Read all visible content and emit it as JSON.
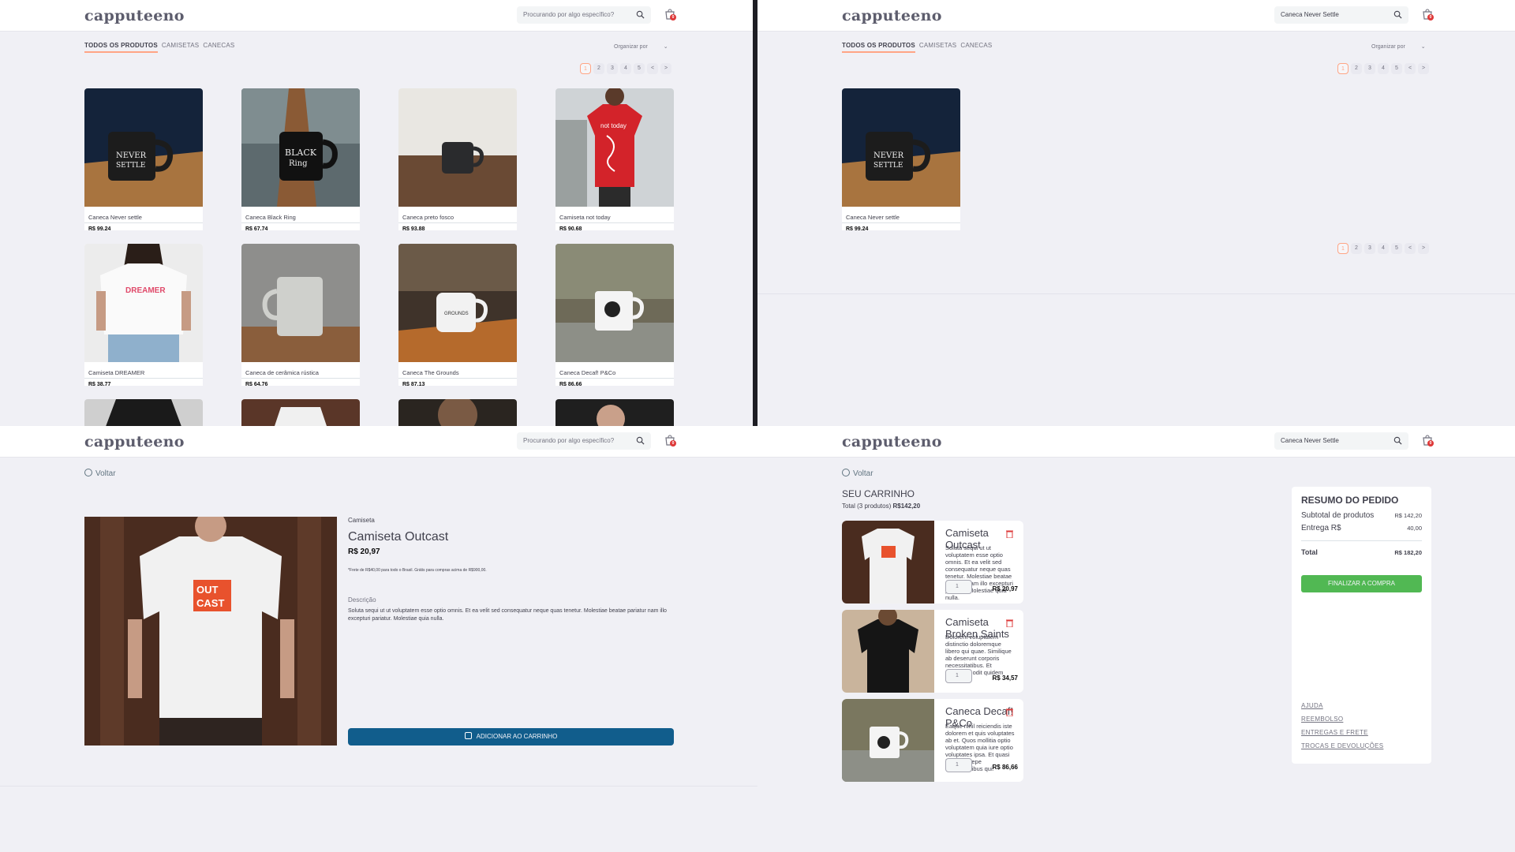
{
  "brand": "capputeeno",
  "search": {
    "placeholder": "Procurando por algo específico?",
    "query": "Caneca Never Settle"
  },
  "cart": {
    "count": "0",
    "icon": "shopping-bag-icon"
  },
  "filters": {
    "tabs": [
      "TODOS OS PRODUTOS",
      "CAMISETAS",
      "CANECAS"
    ],
    "active": "TODOS OS PRODUTOS",
    "sort_label": "Organizar por"
  },
  "pagination": {
    "pages": [
      "1",
      "2",
      "3",
      "4",
      "5"
    ],
    "prev": "<",
    "next": ">",
    "current": "1"
  },
  "catalog": {
    "products": [
      {
        "name": "Caneca Never settle",
        "price": "R$ 99,24"
      },
      {
        "name": "Caneca Black Ring",
        "price": "R$ 67,74"
      },
      {
        "name": "Caneca preto fosco",
        "price": "R$ 93,88"
      },
      {
        "name": "Camiseta not today",
        "price": "R$ 90,68"
      },
      {
        "name": "Camiseta DREAMER",
        "price": "R$ 38,77"
      },
      {
        "name": "Caneca de cerâmica rústica",
        "price": "R$ 64,76"
      },
      {
        "name": "Caneca The Grounds",
        "price": "R$ 87,13"
      },
      {
        "name": "Caneca Decaf! P&Co",
        "price": "R$ 86,66"
      }
    ]
  },
  "search_results": {
    "products": [
      {
        "name": "Caneca Never settle",
        "price": "R$ 99,24"
      }
    ]
  },
  "product": {
    "back": "Voltar",
    "category": "Camiseta",
    "name": "Camiseta Outcast",
    "price": "R$ 20,97",
    "shipping_note": "*Frete de R$40,00 para todo o Brasil. Grátis para compras acima de R$900,00.",
    "desc_title": "Descrição",
    "description": "Soluta sequi ut ut voluptatem esse optio omnis. Et ea velit sed consequatur neque quas tenetur. Molestiae beatae pariatur nam illo excepturi pariatur. Molestiae quia nulla.",
    "add_button": "ADICIONAR AO CARRINHO"
  },
  "cart_page": {
    "back": "Voltar",
    "title": "SEU CARRINHO",
    "total_label": "Total (3 produtos)",
    "total_value": "R$142,20",
    "items": [
      {
        "name": "Camiseta Outcast",
        "desc": "Soluta sequi ut ut voluptatem esse optio omnis. Et ea velit sed consequatur neque quas tenetur. Molestiae beatae pariatur nam illo excepturi pariatur. Molestiae quia nulla.",
        "qty": "1",
        "price": "R$ 20,97"
      },
      {
        "name": "Camiseta Broken Saints",
        "desc": "Dolorem voluptatem distinctio doloremque libero qui quae. Similique ab deserunt corporis necessitatibus. Et architecto odit quidem quos.",
        "qty": "1",
        "price": "R$ 34,57"
      },
      {
        "name": "Caneca Decaf! P&Co",
        "desc": "Eaque nihil reiciendis iste dolorem et quis voluptates ab et. Quos mollitia optio voluptatem quia iure optio voluptates ipsa. Et quasi ipsum. Saepe necessitatibus qui.",
        "qty": "1",
        "price": "R$ 86,66"
      }
    ],
    "summary": {
      "title": "RESUMO DO PEDIDO",
      "subtotal_label": "Subtotal de produtos",
      "subtotal": "R$ 142,20",
      "delivery_label": "Entrega R$",
      "delivery": "40,00",
      "total_label": "Total",
      "total": "R$ 182,20",
      "checkout": "FINALIZAR A COMPRA",
      "links": [
        "AJUDA",
        "REEMBOLSO",
        "ENTREGAS E FRETE",
        "TROCAS E DEVOLUÇÕES"
      ]
    }
  },
  "colors": {
    "accent": "#FFA585",
    "primary_button": "#115D8C",
    "checkout_button": "#51B853",
    "badge": "#DE3838",
    "background": "#F0F0F5"
  }
}
